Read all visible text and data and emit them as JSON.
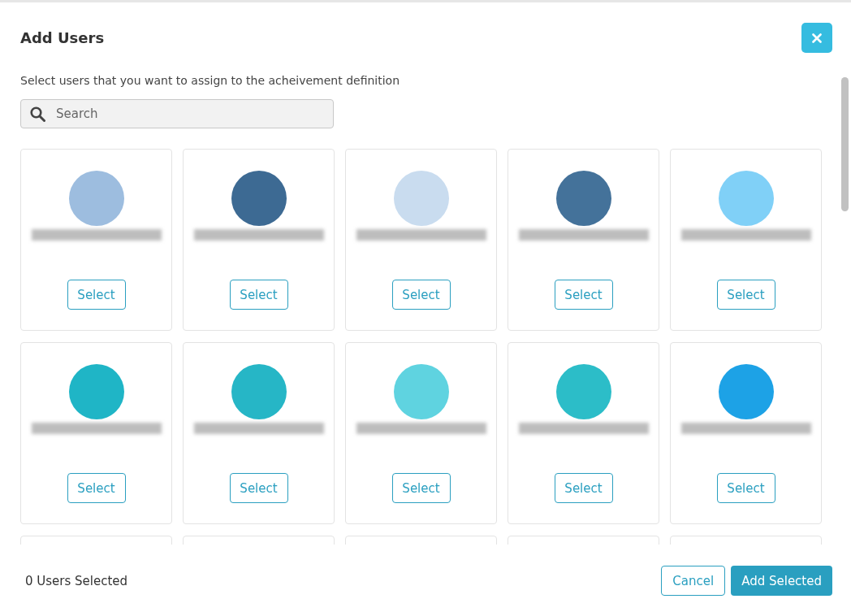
{
  "dialog": {
    "title": "Add Users",
    "description": "Select users that you want to assign to the acheivement definition"
  },
  "search": {
    "placeholder": "Search"
  },
  "users": [
    {
      "kind": "full",
      "color": "#9dbddf",
      "button": "Select"
    },
    {
      "kind": "full",
      "color": "#3d6a93",
      "button": "Select"
    },
    {
      "kind": "full",
      "color": "#c9dcef",
      "button": "Select"
    },
    {
      "kind": "full",
      "color": "#44729a",
      "button": "Select"
    },
    {
      "kind": "full",
      "color": "#80d0f7",
      "button": "Select"
    },
    {
      "kind": "full",
      "color": "#1fb5c6",
      "button": "Select"
    },
    {
      "kind": "full",
      "color": "#26b6c6",
      "button": "Select"
    },
    {
      "kind": "full",
      "color": "#5fd3e0",
      "button": "Select"
    },
    {
      "kind": "full",
      "color": "#2cbdc8",
      "button": "Select"
    },
    {
      "kind": "full",
      "color": "#1da2e6",
      "button": "Select"
    },
    {
      "kind": "partial"
    },
    {
      "kind": "partial"
    },
    {
      "kind": "partial"
    },
    {
      "kind": "partial"
    },
    {
      "kind": "partial"
    }
  ],
  "footer": {
    "count": "0 Users Selected",
    "cancel": "Cancel",
    "add": "Add Selected"
  }
}
